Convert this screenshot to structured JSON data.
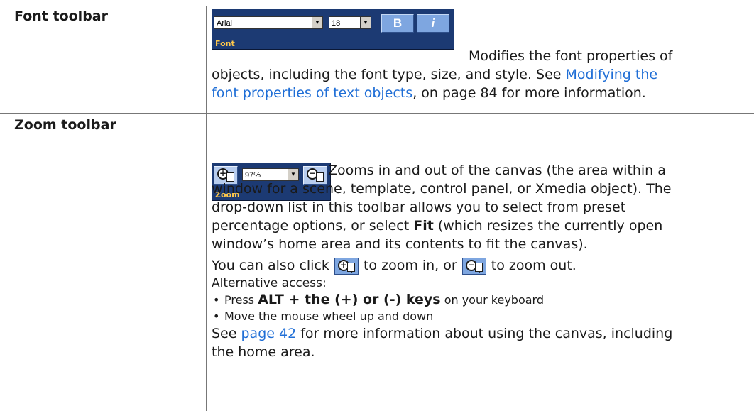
{
  "rows": [
    {
      "term": "Font toolbar",
      "toolbar": {
        "font_value": "Arial",
        "size_value": "18",
        "bold_label": "B",
        "italic_label": "i",
        "caption": "Font"
      },
      "desc_1": "Modifies the font properties of",
      "desc_2": "objects, including the font type, size, and style. See ",
      "link_1": "Modifying the",
      "link_2": "font properties of text objects",
      "desc_3": ", on page 84 for more information."
    },
    {
      "term": "Zoom toolbar",
      "toolbar": {
        "zoom_value": "97%",
        "caption": "Zoom"
      },
      "desc_1": "Zooms in and out of the canvas (the area within a",
      "desc_2": "window for a scene, template, control panel, or Xmedia object). The",
      "desc_3": "drop-down list in this toolbar allows you to select from preset",
      "desc_4a": "percentage options, or select ",
      "desc_4b": "Fit",
      "desc_4c": " (which resizes the currently open",
      "desc_5": "window’s home area and its contents to fit the canvas).",
      "click_a": "You can also click ",
      "click_b": " to zoom in, or ",
      "click_c": " to zoom out.",
      "alt_heading": "Alternative access:",
      "bullets": [
        {
          "a": "Press ",
          "b": "ALT + the (+) or (-) keys",
          "c": " on your keyboard"
        },
        {
          "a": "Move the mouse wheel up and down"
        }
      ],
      "see_a": "See ",
      "see_link": "page 42",
      "see_b": " for more information about using the canvas, including",
      "see_c": "the home area."
    }
  ],
  "icons": [
    "zoom-in-icon",
    "zoom-out-icon",
    "dropdown-arrow-icon"
  ],
  "colors": {
    "link": "#1f6ed6",
    "toolbar_bg": "#1c3a73",
    "toolbar_caption": "#ffc84a"
  }
}
